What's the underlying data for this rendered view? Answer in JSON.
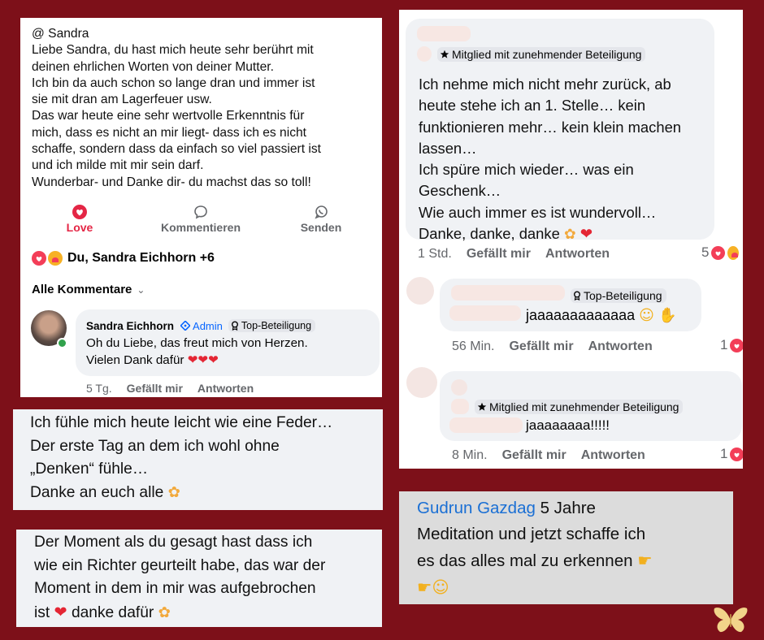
{
  "post": {
    "lines": [
      "@ Sandra",
      "Liebe Sandra, du hast mich heute sehr berührt mit",
      "deinen ehrlichen Worten von deiner Mutter.",
      "Ich bin da auch schon so lange dran und immer ist",
      "sie mit dran am Lagerfeuer usw.",
      "Das war heute eine sehr wertvolle Erkenntnis für",
      "mich, dass es nicht an mir liegt- dass ich es nicht",
      "schaffe, sondern dass da einfach so viel passiert ist",
      "und ich milde mit mir sein darf.",
      "Wunderbar- und Danke dir- du machst das so toll!"
    ],
    "actions": {
      "love": "Love",
      "comment": "Kommentieren",
      "send": "Senden"
    },
    "reactions_text": "Du, Sandra Eichhorn +6",
    "all_comments": "Alle Kommentare",
    "reply": {
      "author": "Sandra Eichhorn",
      "admin": "Admin",
      "badge": "Top-Beteiligung",
      "line1": "Oh du Liebe, das freut mich von Herzen.",
      "line2": "Vielen Dank dafür",
      "time": "5 Tg.",
      "like": "Gefällt mir",
      "answer": "Antworten"
    }
  },
  "comments": [
    {
      "badge": "Mitglied mit zunehmender Beteiligung",
      "lines": [
        "Ich nehme mich nicht mehr zurück, ab",
        "heute stehe ich an 1. Stelle… kein",
        "funktionieren mehr… kein klein machen",
        "lassen…",
        "Ich spüre mich wieder… was ein",
        "Geschenk…",
        "Wie auch immer es ist wundervoll…",
        "Danke, danke, danke"
      ],
      "time": "1 Std.",
      "like": "Gefällt mir",
      "answer": "Antworten",
      "count": "5"
    },
    {
      "badge": "Top-Beteiligung",
      "text": "jaaaaaaaaaaaaa",
      "time": "56 Min.",
      "like": "Gefällt mir",
      "answer": "Antworten",
      "count": "1"
    },
    {
      "badge": "Mitglied mit zunehmender Beteiligung",
      "text": "jaaaaaaaa!!!!!",
      "time": "8 Min.",
      "like": "Gefällt mir",
      "answer": "Antworten",
      "count": "1"
    }
  ],
  "quote_feather": {
    "lines": [
      "Ich fühle mich heute leicht wie eine Feder…",
      "Der erste Tag an dem ich wohl ohne",
      "„Denken“ fühle…",
      "Danke an euch alle"
    ]
  },
  "quote_judge": {
    "lines": [
      "Der Moment als du gesagt hast dass ich",
      "wie ein Richter geurteilt habe, das war der",
      "Moment in dem in mir was aufgebrochen",
      "ist",
      "danke dafür"
    ]
  },
  "quote_gudrun": {
    "author": "Gudrun Gazdag",
    "lines": [
      "5 Jahre",
      "Meditation und jetzt schaffe ich",
      "es das alles mal zu erkennen"
    ]
  },
  "colors": {
    "background": "#7d1019",
    "love": "#e42645",
    "admin": "#0866ff",
    "link": "#1a6fd4",
    "butterfly": "#f2d48a"
  },
  "icons": [
    "heart-icon",
    "comment-icon",
    "whatsapp-icon",
    "admin-shield-icon",
    "badge-icon",
    "star-icon",
    "butterfly-icon"
  ]
}
